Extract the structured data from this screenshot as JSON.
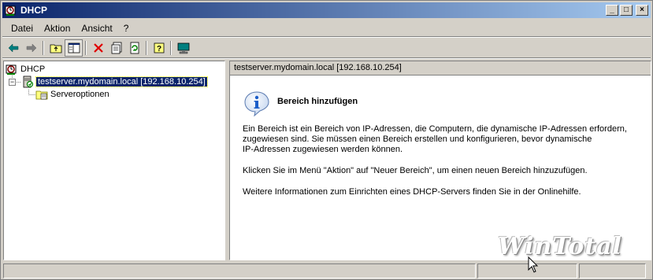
{
  "window": {
    "title": "DHCP",
    "controls": {
      "minimize": "_",
      "maximize": "□",
      "close": "×"
    }
  },
  "menu": [
    {
      "label": "Datei"
    },
    {
      "label": "Aktion"
    },
    {
      "label": "Ansicht"
    },
    {
      "label": "?"
    }
  ],
  "toolbar": {
    "icons": [
      "back-arrow-icon",
      "forward-arrow-icon",
      "up-folder-icon",
      "show-hide-tree-icon",
      "delete-icon",
      "properties-icon",
      "refresh-icon",
      "help-icon",
      "console-icon"
    ]
  },
  "tree": {
    "root": "DHCP",
    "server": "testserver.mydomain.local [192.168.10.254]",
    "server_expander": "−",
    "child": "Serveroptionen"
  },
  "details": {
    "header": "testserver.mydomain.local [192.168.10.254]",
    "title": "Bereich hinzufügen",
    "para1_line1": "Ein Bereich ist ein Bereich von IP-Adressen, die Computern, die dynamische IP-Adressen erfordern,",
    "para1_line2": "zugewiesen sind. Sie müssen einen Bereich erstellen und konfigurieren, bevor dynamische",
    "para1_line3": "IP-Adressen zugewiesen werden können.",
    "para2": "Klicken Sie im Menü \"Aktion\" auf \"Neuer Bereich\", um einen neuen Bereich hinzuzufügen.",
    "para3": "Weitere Informationen zum Einrichten eines DHCP-Servers finden Sie in der Onlinehilfe."
  },
  "watermark": "WinTotal",
  "colors": {
    "titlebar_start": "#0a246a",
    "titlebar_end": "#a6caf0",
    "selection": "#0a246a",
    "info_icon": "#1c5ec8"
  }
}
